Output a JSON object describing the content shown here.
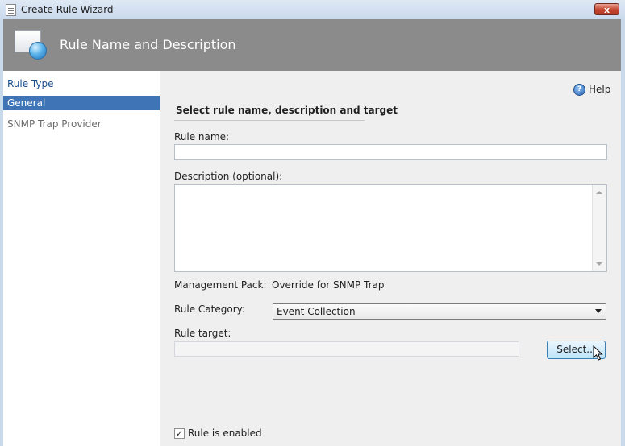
{
  "window": {
    "title": "Create Rule Wizard",
    "close_glyph": "x"
  },
  "header": {
    "title": "Rule Name and Description",
    "icon": "wizard-page-icon"
  },
  "nav": {
    "items": [
      {
        "label": "Rule Type",
        "state": "link"
      },
      {
        "label": "General",
        "state": "active"
      },
      {
        "label": "SNMP Trap Provider",
        "state": "disabled"
      }
    ]
  },
  "help": {
    "label": "Help",
    "icon": "help-icon"
  },
  "form": {
    "section_title": "Select rule name, description and target",
    "rule_name_label": "Rule name:",
    "rule_name_value": "",
    "description_label": "Description (optional):",
    "description_value": "",
    "management_pack_label": "Management Pack:",
    "management_pack_value": "Override for SNMP Trap",
    "rule_category_label": "Rule Category:",
    "rule_category_value": "Event Collection",
    "rule_target_label": "Rule target:",
    "rule_target_value": "",
    "select_button_label": "Select...",
    "enabled_label": "Rule is enabled",
    "enabled_checked": true
  },
  "colors": {
    "header_bg": "#8b8b8b",
    "nav_active_bg": "#3f75b7",
    "content_bg": "#efefef"
  }
}
